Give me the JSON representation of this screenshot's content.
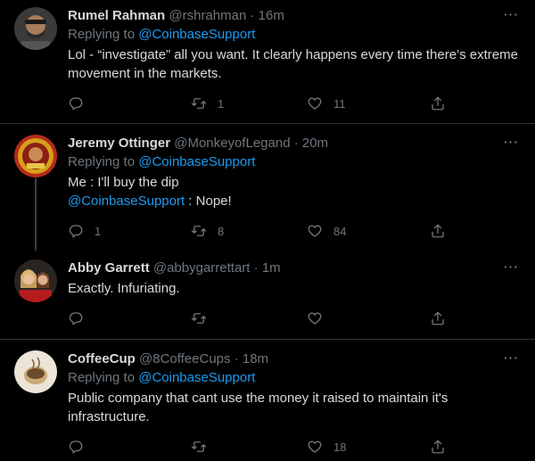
{
  "colors": {
    "background": "#000000",
    "link": "#1d9bf0",
    "muted": "#6e767d",
    "text": "#d9d9d9"
  },
  "tweets": [
    {
      "name": "Rumel Rahman",
      "handle": "@rshrahman",
      "dot": "·",
      "time": "16m",
      "replying_label": "Replying to",
      "replying_to": "@CoinbaseSupport",
      "text": "Lol - “investigate” all you want. It clearly happens every time there’s extreme movement in the markets.",
      "replies": "",
      "retweets": "1",
      "likes": "11"
    },
    {
      "name": "Jeremy Ottinger",
      "handle": "@MonkeyofLegand",
      "dot": "·",
      "time": "20m",
      "replying_label": "Replying to",
      "replying_to": "@CoinbaseSupport",
      "text_line1": "Me : I'll buy the dip",
      "mention": "@CoinbaseSupport",
      "text_line2_rest": " : Nope!",
      "replies": "1",
      "retweets": "8",
      "likes": "84"
    },
    {
      "name": "Abby Garrett",
      "handle": "@abbygarrettart",
      "dot": "·",
      "time": "1m",
      "text": "Exactly. Infuriating.",
      "replies": "",
      "retweets": "",
      "likes": ""
    },
    {
      "name": "CoffeeCup",
      "handle": "@8CoffeeCups",
      "dot": "·",
      "time": "18m",
      "replying_label": "Replying to",
      "replying_to": "@CoinbaseSupport",
      "text": "Public company that cant use the money it raised to maintain it's infrastructure.",
      "replies": "",
      "retweets": "",
      "likes": "18"
    }
  ],
  "icons": {
    "more": "more-icon",
    "reply": "reply-icon",
    "retweet": "retweet-icon",
    "like": "heart-icon",
    "share": "share-icon"
  },
  "more_glyph": "···"
}
